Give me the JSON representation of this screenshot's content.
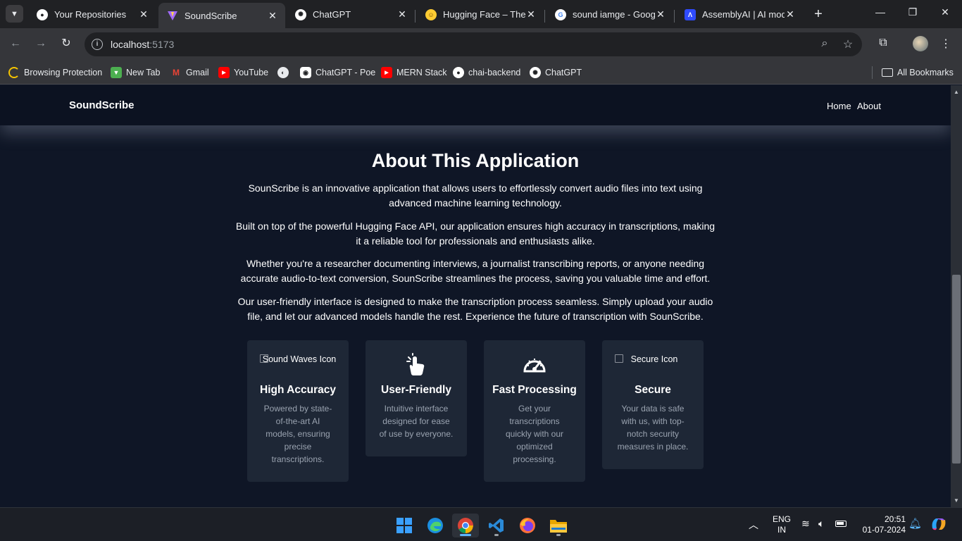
{
  "browser": {
    "tabs": [
      {
        "title": "Your Repositories",
        "icon": "github-icon",
        "active": false
      },
      {
        "title": "SoundScribe",
        "icon": "vite-icon",
        "active": true
      },
      {
        "title": "ChatGPT",
        "icon": "openai-icon",
        "active": false
      },
      {
        "title": "Hugging Face – The A",
        "icon": "huggingface-icon",
        "active": false
      },
      {
        "title": "sound iamge - Googl",
        "icon": "google-icon",
        "active": false
      },
      {
        "title": "AssemblyAI | AI mode",
        "icon": "assemblyai-icon",
        "active": false
      }
    ],
    "url_host": "localhost",
    "url_port": ":5173",
    "bookmarks": [
      {
        "label": "Browsing Protection",
        "icon": "protection-icon"
      },
      {
        "label": "New Tab",
        "icon": "newtab-icon"
      },
      {
        "label": "Gmail",
        "icon": "gmail-icon"
      },
      {
        "label": "YouTube",
        "icon": "youtube-icon"
      },
      {
        "label": "",
        "icon": "globe-icon"
      },
      {
        "label": "ChatGPT - Poe",
        "icon": "poe-icon"
      },
      {
        "label": "MERN Stack",
        "icon": "youtube-icon"
      },
      {
        "label": "chai-backend",
        "icon": "github-icon"
      },
      {
        "label": "ChatGPT",
        "icon": "openai-icon"
      }
    ],
    "all_bookmarks": "All Bookmarks"
  },
  "site": {
    "brand": "SoundScribe",
    "nav": [
      "Home",
      "About"
    ],
    "about_title": "About This Application",
    "paragraphs": [
      "SounScribe is an innovative application that allows users to effortlessly convert audio files into text using advanced machine learning technology.",
      "Built on top of the powerful Hugging Face API, our application ensures high accuracy in transcriptions, making it a reliable tool for professionals and enthusiasts alike.",
      "Whether you're a researcher documenting interviews, a journalist transcribing reports, or anyone needing accurate audio-to-text conversion, SounScribe streamlines the process, saving you valuable time and effort.",
      "Our user-friendly interface is designed to make the transcription process seamless. Simply upload your audio file, and let our advanced models handle the rest. Experience the future of transcription with SounScribe."
    ],
    "features": [
      {
        "img_alt": "Sound Waves Icon",
        "icon": "broken-image-icon",
        "title": "High Accuracy",
        "desc": "Powered by state-of-the-art AI models, ensuring precise transcriptions."
      },
      {
        "img_alt": "",
        "icon": "hand-pointer-icon",
        "title": "User-Friendly",
        "desc": "Intuitive interface designed for ease of use by everyone."
      },
      {
        "img_alt": "",
        "icon": "speedometer-icon",
        "title": "Fast Processing",
        "desc": "Get your transcriptions quickly with our optimized processing."
      },
      {
        "img_alt": "Secure Icon",
        "icon": "broken-image-icon",
        "title": "Secure",
        "desc": "Your data is safe with us, with top-notch security measures in place."
      }
    ]
  },
  "taskbar": {
    "apps": [
      "windows-start-icon",
      "edge-icon",
      "chrome-icon",
      "vscode-icon",
      "firefox-icon",
      "file-explorer-icon"
    ],
    "lang_top": "ENG",
    "lang_bottom": "IN",
    "time": "20:51",
    "date": "01-07-2024"
  }
}
